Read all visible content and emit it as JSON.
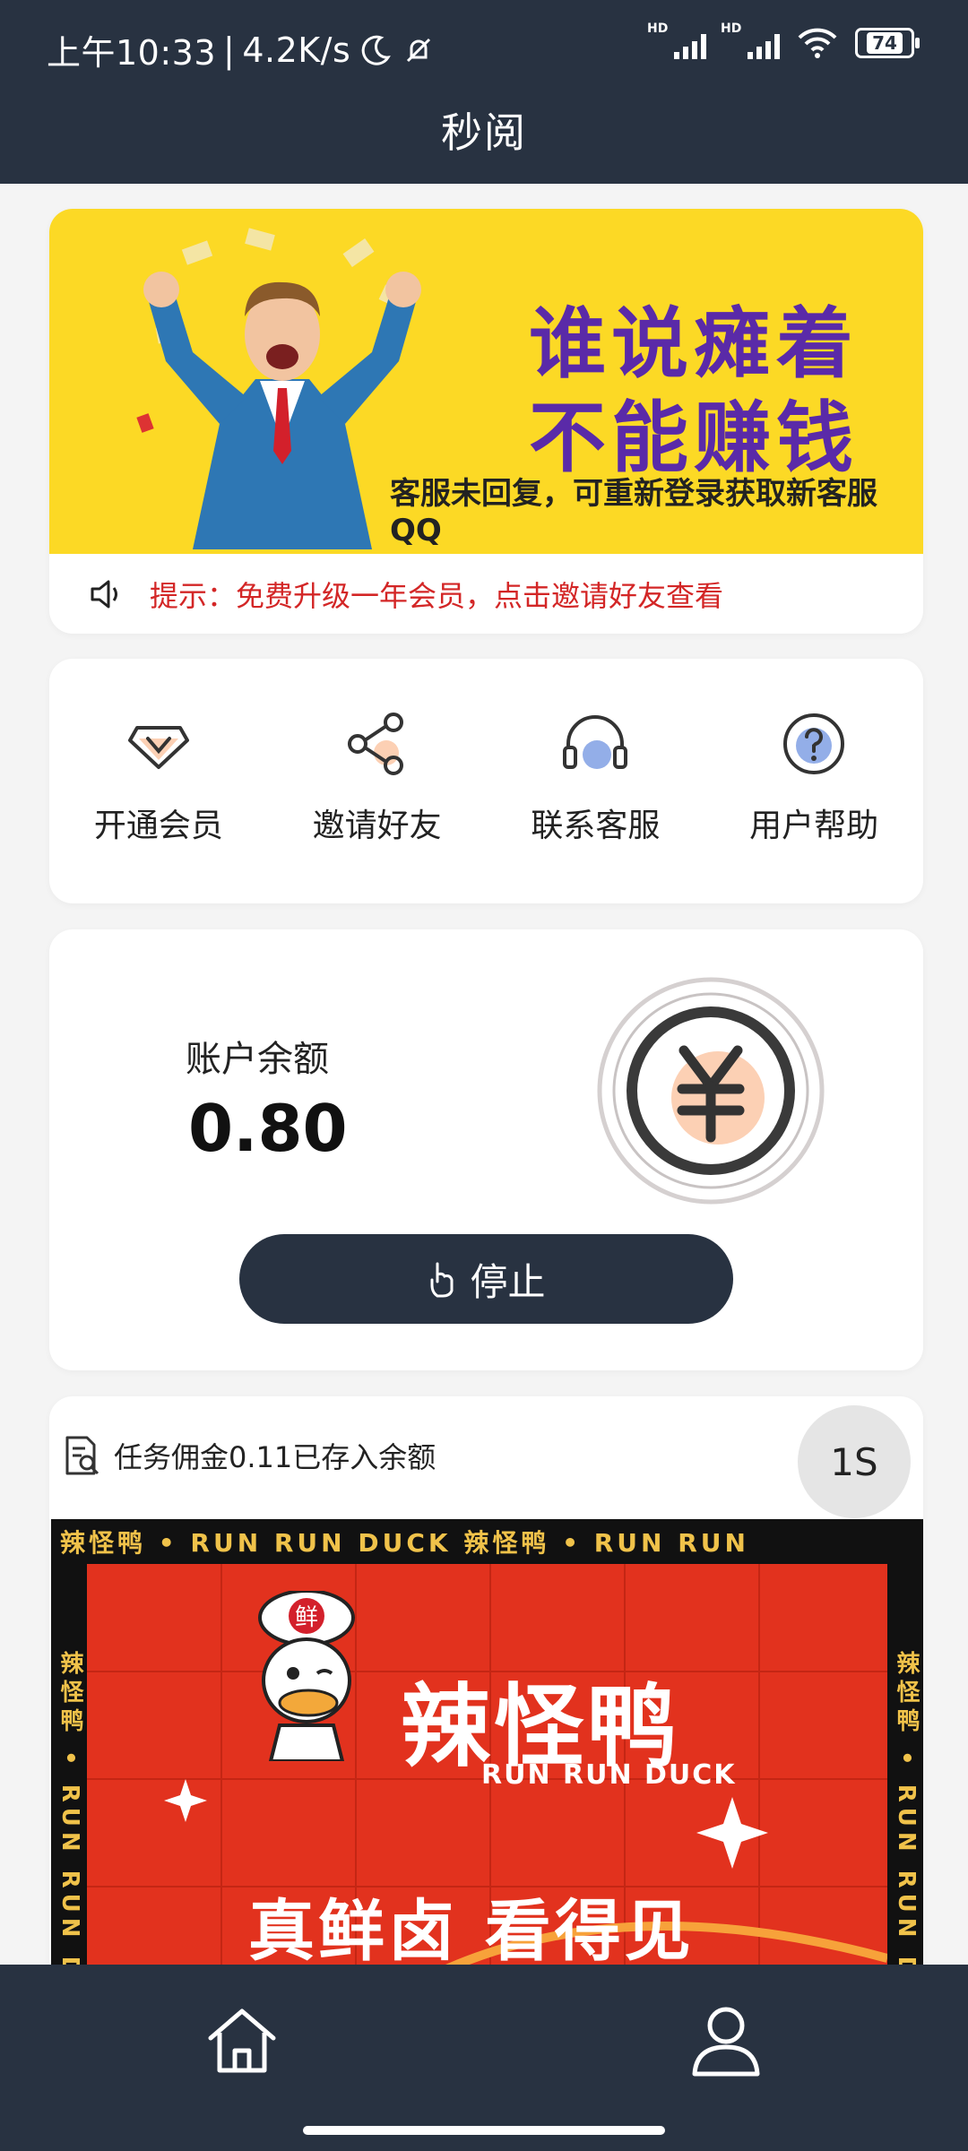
{
  "status_bar": {
    "time": "上午10:33",
    "speed": "4.2K/s",
    "battery": "74",
    "hd_label": "HD"
  },
  "header": {
    "title": "秒阅"
  },
  "banner": {
    "slogan_line1": "谁说瘫着",
    "slogan_line2": "不能赚钱",
    "caption": "客服未回复，可重新登录获取新客服QQ",
    "tip": "提示：免费升级一年会员，点击邀请好友查看"
  },
  "menu": [
    {
      "label": "开通会员",
      "icon": "vip-diamond-icon"
    },
    {
      "label": "邀请好友",
      "icon": "share-icon"
    },
    {
      "label": "联系客服",
      "icon": "headset-icon"
    },
    {
      "label": "用户帮助",
      "icon": "help-question-icon"
    }
  ],
  "balance": {
    "label": "账户余额",
    "value": "0.80",
    "stop_label": "停止"
  },
  "task": {
    "message": "任务佣金0.11已存入余额",
    "timer": "1S"
  },
  "ad": {
    "strip_text": "辣怪鸭 • RUN RUN DUCK     辣怪鸭 • RUN RUN",
    "side_text": "辣怪鸭 • RUN RUN DUCK",
    "brand_cn": "辣怪鸭",
    "brand_en": "RUN RUN DUCK",
    "chef_badge": "鲜",
    "slogan": "真鲜卤 看得见"
  },
  "colors": {
    "dark": "#283241",
    "banner_yellow": "#fcd925",
    "slogan_purple": "#5a2aa8",
    "tip_red": "#d32626",
    "ad_red": "#e2321e",
    "accent_peach": "#fcd0b4",
    "accent_blue": "#93aee8"
  }
}
